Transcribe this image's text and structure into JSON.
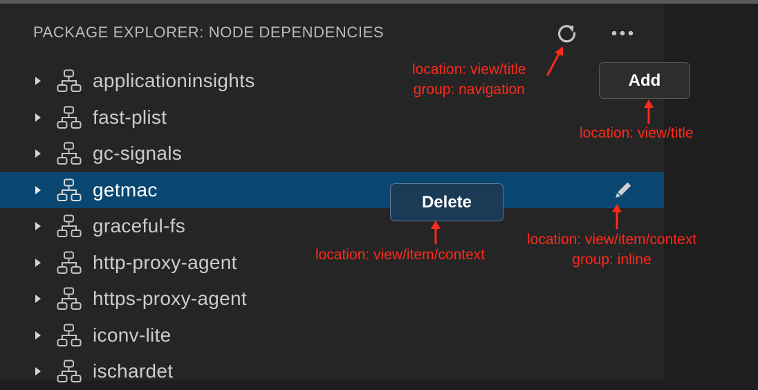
{
  "view": {
    "title": "PACKAGE EXPLORER: NODE DEPENDENCIES",
    "actions": [
      {
        "name": "refresh-icon"
      },
      {
        "name": "more-actions-icon"
      }
    ]
  },
  "tree": {
    "items": [
      {
        "label": "applicationinsights",
        "selected": false
      },
      {
        "label": "fast-plist",
        "selected": false
      },
      {
        "label": "gc-signals",
        "selected": false
      },
      {
        "label": "getmac",
        "selected": true
      },
      {
        "label": "graceful-fs",
        "selected": false
      },
      {
        "label": "http-proxy-agent",
        "selected": false
      },
      {
        "label": "https-proxy-agent",
        "selected": false
      },
      {
        "label": "iconv-lite",
        "selected": false
      },
      {
        "label": "ischardet",
        "selected": false
      }
    ],
    "item_icon": "dependency-icon",
    "inline_action_icon": "pencil-icon"
  },
  "callouts": {
    "add_label": "Add",
    "delete_label": "Delete"
  },
  "annotations": {
    "refresh_line1": "location: view/title",
    "refresh_line2": "group: navigation",
    "add": "location: view/title",
    "delete": "location: view/item/context",
    "inline_line1": "location: view/item/context",
    "inline_line2": "group: inline"
  },
  "colors": {
    "selection": "#094771",
    "annotation": "#ff2a1a"
  }
}
